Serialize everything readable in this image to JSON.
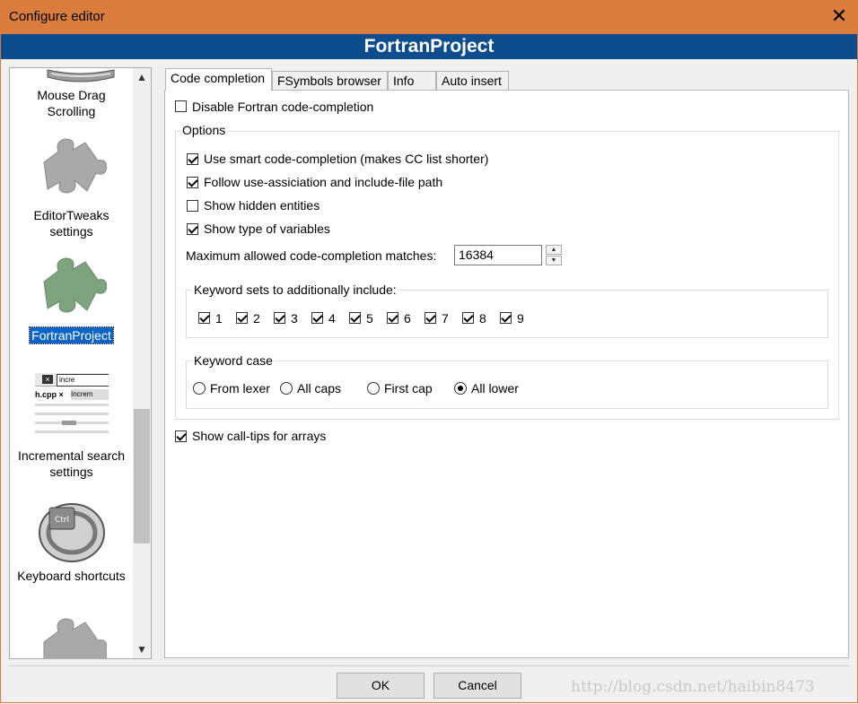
{
  "window": {
    "title": "Configure editor",
    "close_glyph": "✕"
  },
  "header": {
    "title": "FortranProject"
  },
  "sidebar": {
    "items": [
      {
        "label": "Mouse Drag\nScrolling",
        "icon": "mouse-drag-icon"
      },
      {
        "label": "EditorTweaks\nsettings",
        "icon": "puzzle-piece-icon"
      },
      {
        "label": "FortranProject",
        "icon": "puzzle-piece-green-icon",
        "selected": true
      },
      {
        "label": "Incremental search\nsettings",
        "icon": "incremental-search-icon",
        "thumb_text": "incre",
        "thumb_tab1": "h.cpp ×",
        "thumb_tab2": "Increm"
      },
      {
        "label": "Keyboard shortcuts",
        "icon": "keyboard-ctrl-icon",
        "key_text": "Ctrl"
      },
      {
        "label": "",
        "icon": "puzzle-piece-icon"
      }
    ],
    "scroll_up_glyph": "▲",
    "scroll_down_glyph": "▼"
  },
  "tabs": [
    {
      "label": "Code completion",
      "active": true
    },
    {
      "label": "FSymbols browser",
      "active": false
    },
    {
      "label": "Info",
      "active": false
    },
    {
      "label": "Auto insert",
      "active": false
    }
  ],
  "panel": {
    "disable_cc": {
      "label": "Disable Fortran code-completion",
      "checked": false
    },
    "options_group": {
      "legend": "Options",
      "smart_cc": {
        "label": "Use smart code-completion (makes CC list shorter)",
        "checked": true
      },
      "follow_use": {
        "label": "Follow use-assiciation and include-file path",
        "checked": true
      },
      "show_hidden": {
        "label": "Show hidden entities",
        "checked": false
      },
      "show_type": {
        "label": "Show type of variables",
        "checked": true
      },
      "max_matches": {
        "label": "Maximum allowed code-completion matches:",
        "value": "16384"
      },
      "keyword_sets": {
        "legend": "Keyword sets to additionally include:",
        "items": [
          "1",
          "2",
          "3",
          "4",
          "5",
          "6",
          "7",
          "8",
          "9"
        ],
        "checked": [
          true,
          true,
          true,
          true,
          true,
          true,
          true,
          true,
          true
        ]
      },
      "keyword_case": {
        "legend": "Keyword case",
        "options": [
          "From lexer",
          "All caps",
          "First cap",
          "All lower"
        ],
        "selected": "All lower"
      }
    },
    "call_tips": {
      "label": "Show call-tips for arrays",
      "checked": true
    }
  },
  "buttons": {
    "ok": "OK",
    "cancel": "Cancel"
  },
  "watermark": "http://blog.csdn.net/haibin8473",
  "colors": {
    "title_bar": "#d97c3c",
    "header_bar": "#0d4d8e",
    "selection": "#0a64c8"
  }
}
